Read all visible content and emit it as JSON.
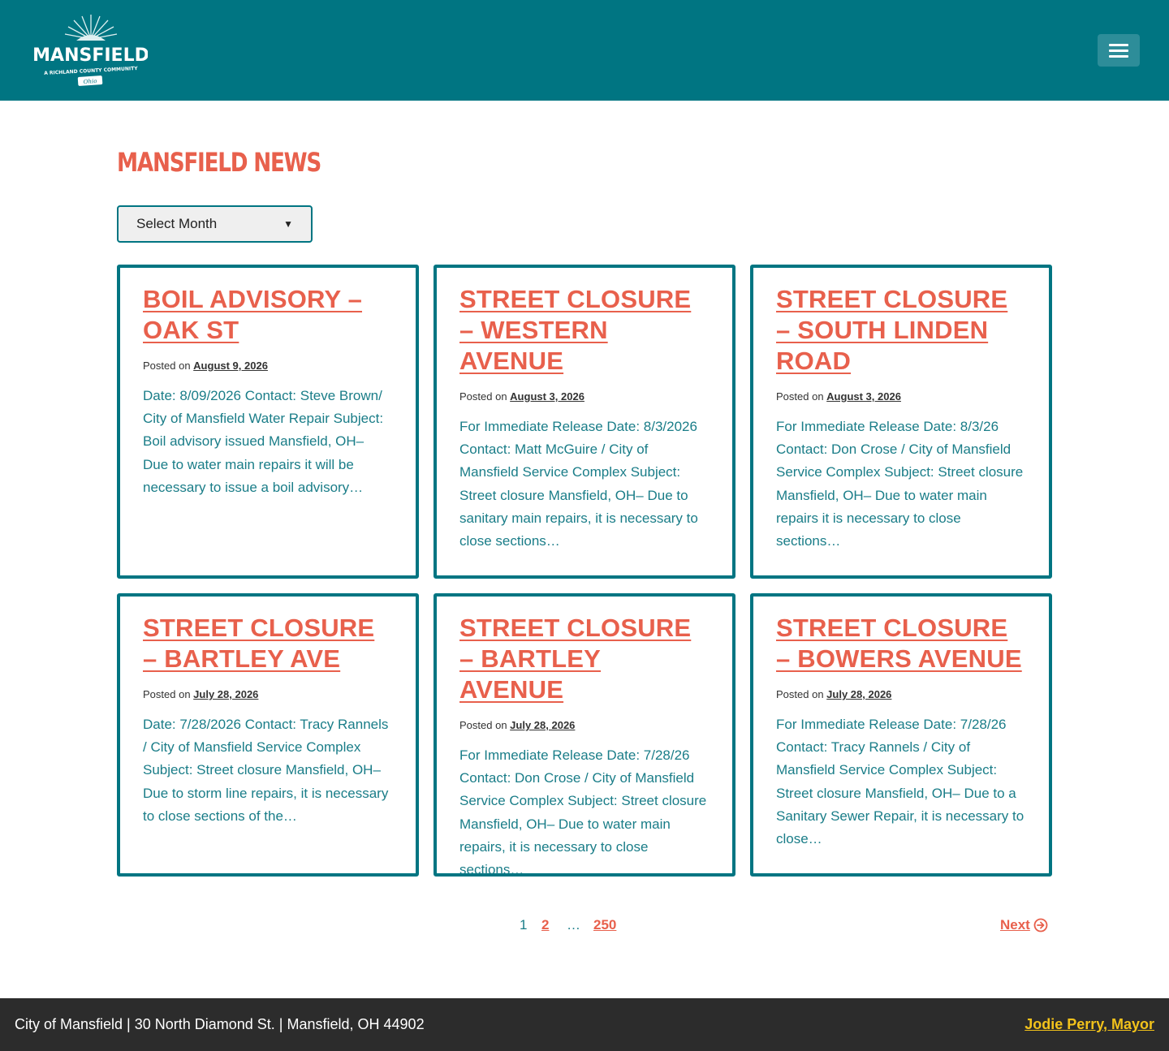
{
  "header": {
    "logo_text": "MANSFIELD",
    "logo_tagline": "A RICHLAND COUNTY COMMUNITY",
    "logo_badge": "Ohio",
    "menu_icon": "hamburger-menu-icon"
  },
  "page": {
    "title": "MANSFIELD NEWS",
    "month_select": {
      "selected": "Select Month"
    }
  },
  "posts": [
    {
      "title": "BOIL ADVISORY – OAK ST",
      "posted_label": "Posted on",
      "date": "August 9, 2026",
      "excerpt": "Date:  8/09/2026 Contact:  Steve Brown/ City of Mansfield Water Repair Subject:  Boil advisory issued Mansfield, OH– Due to water main repairs it will be necessary to issue a boil advisory…"
    },
    {
      "title": "STREET CLOSURE – WESTERN AVENUE",
      "posted_label": "Posted on",
      "date": "August 3, 2026",
      "excerpt": "For Immediate Release Date: 8/3/2026 Contact: Matt McGuire / City of Mansfield Service Complex Subject: Street closure Mansfield, OH– Due to sanitary main repairs, it is necessary to close sections…"
    },
    {
      "title": "STREET CLOSURE – SOUTH LINDEN ROAD",
      "posted_label": "Posted on",
      "date": "August 3, 2026",
      "excerpt": "For Immediate Release Date: 8/3/26 Contact: Don Crose / City of Mansfield Service Complex Subject: Street closure Mansfield, OH– Due to water main repairs it is necessary to close sections…"
    },
    {
      "title": "STREET CLOSURE – BARTLEY AVE",
      "posted_label": "Posted on",
      "date": "July 28, 2026",
      "excerpt": "Date: 7/28/2026                    Contact:  Tracy Rannels / City of Mansfield Service Complex Subject:  Street closure Mansfield, OH– Due to storm line repairs, it is necessary to close sections of the…"
    },
    {
      "title": "STREET CLOSURE – BARTLEY AVENUE",
      "posted_label": "Posted on",
      "date": "July 28, 2026",
      "excerpt": "For Immediate Release Date: 7/28/26 Contact: Don Crose / City of Mansfield Service Complex Subject: Street closure Mansfield, OH– Due to water main repairs, it is necessary to close sections…"
    },
    {
      "title": "STREET CLOSURE – BOWERS AVENUE",
      "posted_label": "Posted on",
      "date": "July 28, 2026",
      "excerpt": "For Immediate Release Date: 7/28/26 Contact: Tracy Rannels / City of Mansfield Service Complex Subject: Street closure Mansfield, OH– Due to a Sanitary Sewer Repair, it is necessary to close…"
    }
  ],
  "pagination": {
    "current": "1",
    "page2": "2",
    "dots": "…",
    "last": "250",
    "next_label": "Next",
    "next_icon": "arrow-right-circle-icon"
  },
  "footer": {
    "address": "City of Mansfield | 30 North Diamond St. | Mansfield, OH 44902",
    "mayor_link": "Jodie Perry, Mayor"
  },
  "colors": {
    "header_bg": "#007582",
    "accent": "#e8604c",
    "teal_text": "#1a7d88",
    "footer_bg": "#2c2c2c",
    "footer_link": "#f2c21b"
  }
}
